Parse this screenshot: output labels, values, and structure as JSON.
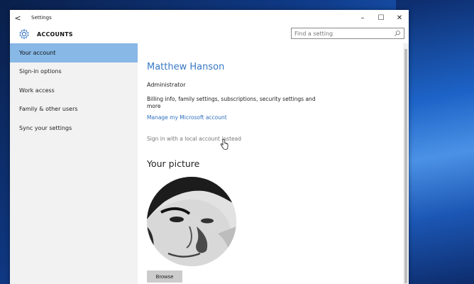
{
  "window": {
    "title": "Settings",
    "back_glyph": "<",
    "controls": {
      "minimize": "–",
      "maximize": "☐",
      "close": "✕"
    }
  },
  "header": {
    "title": "ACCOUNTS",
    "icon": "gear-icon",
    "search_placeholder": "Find a setting"
  },
  "sidebar": {
    "items": [
      {
        "label": "Your account",
        "active": true
      },
      {
        "label": "Sign-in options",
        "active": false
      },
      {
        "label": "Work access",
        "active": false
      },
      {
        "label": "Family & other users",
        "active": false
      },
      {
        "label": "Sync your settings",
        "active": false
      }
    ]
  },
  "main": {
    "user_name": "Matthew Hanson",
    "role": "Administrator",
    "billing_text": "Billing info, family settings, subscriptions, security settings and more",
    "manage_link": "Manage my Microsoft account",
    "local_account_link": "Sign in with a local account instead",
    "picture_heading": "Your picture",
    "browse_label": "Browse"
  },
  "colors": {
    "accent": "#3879c4",
    "sidebar_active": "#87b8e6",
    "link": "#2e6fbf"
  }
}
